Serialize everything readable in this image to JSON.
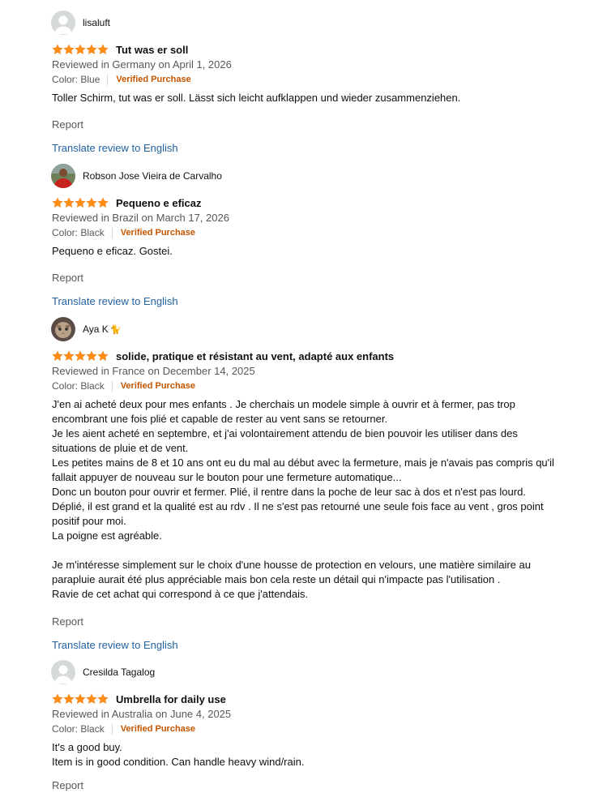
{
  "reviews": [
    {
      "author": "lisaluft",
      "avatar": "default-avatar",
      "emoji": "",
      "rating": 5,
      "title": "Tut was er soll",
      "meta": "Reviewed in Germany on April 1, 2026",
      "color": "Color: Blue",
      "verified": "Verified Purchase",
      "body": "Toller Schirm, tut was er soll. Lässt sich leicht aufklappen und wieder zusammenziehen.",
      "report": "Report",
      "translate": "Translate review to English"
    },
    {
      "author": "Robson Jose Vieira de Carvalho",
      "avatar": "photo-avatar-red",
      "emoji": "",
      "rating": 5,
      "title": "Pequeno e eficaz",
      "meta": "Reviewed in Brazil on March 17, 2026",
      "color": "Color: Black",
      "verified": "Verified Purchase",
      "body": "Pequeno e eficaz. Gostei.",
      "report": "Report",
      "translate": "Translate review to English"
    },
    {
      "author": "Aya K",
      "avatar": "photo-avatar-cat",
      "emoji": "🐈",
      "rating": 5,
      "title": "solide, pratique et résistant au vent, adapté aux enfants",
      "meta": "Reviewed in France on December 14, 2025",
      "color": "Color: Black",
      "verified": "Verified Purchase",
      "body": "J'en ai acheté deux pour mes enfants . Je cherchais un modele simple à ouvrir et à fermer, pas trop\nencombrant une fois plié et capable de rester au vent sans se retourner.\nJe les aient acheté en septembre, et j'ai volontairement attendu de bien pouvoir les utiliser dans des\nsituations de pluie et de vent.\nLes petites mains de 8 et 10 ans ont eu du mal au début avec la fermeture, mais je n'avais pas compris qu'il\nfallait appuyer de nouveau sur le bouton pour une fermeture automatique...\nDonc un bouton pour ouvrir et fermer. Plié, il rentre dans la poche de leur sac à dos et n'est pas lourd.\nDéplié, il est grand et la qualité est au rdv . Il ne s'est pas retourné une seule fois face au vent , gros point\npositif pour moi.\nLa poigne est agréable.\n\nJe m'intéresse simplement sur le choix d'une housse de protection en velours, une matière similaire au\nparapluie aurait été plus appréciable mais bon cela reste un détail qui n'impacte pas l'utilisation .\nRavie de cet achat qui correspond à ce que j'attendais.",
      "report": "Report",
      "translate": "Translate review to English"
    },
    {
      "author": "Cresilda Tagalog",
      "avatar": "default-avatar",
      "emoji": "",
      "rating": 5,
      "title": "Umbrella for daily use",
      "meta": "Reviewed in Australia on June 4, 2025",
      "color": "Color: Black",
      "verified": "Verified Purchase",
      "body": "It's a good buy.\nItem is in good condition. Can handle heavy wind/rain.",
      "report": "Report",
      "translate": ""
    }
  ],
  "colors": {
    "star": "#ff8c14",
    "verified": "#c45500",
    "link": "#2162a1",
    "meta": "#565959"
  }
}
